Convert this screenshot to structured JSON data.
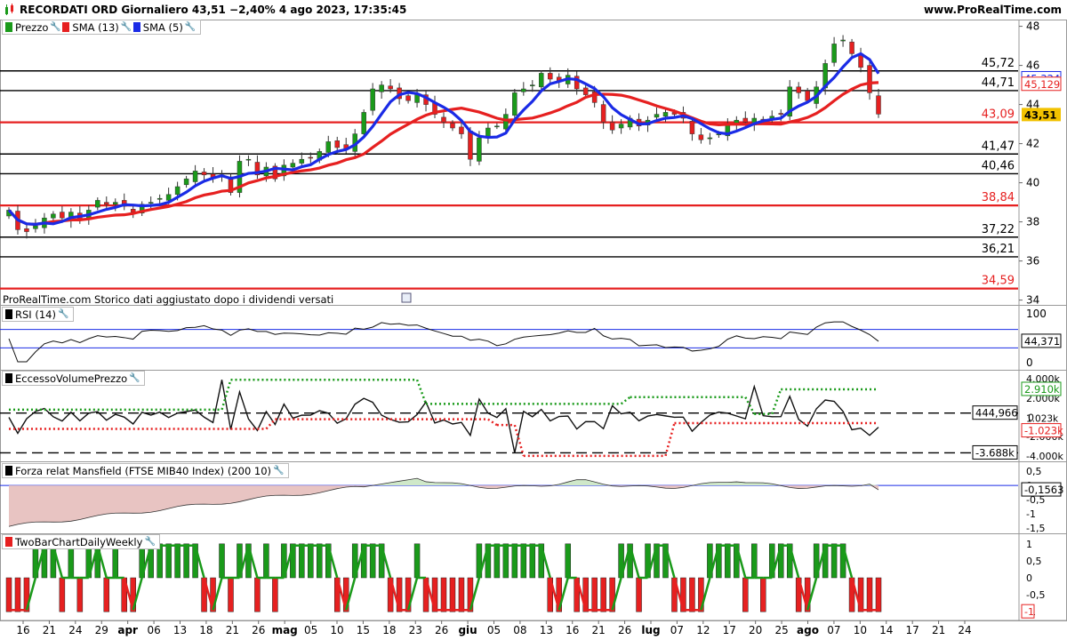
{
  "header": {
    "title": "RECORDATI ORD Giornaliero 43,51 −2,40% 4 ago 2023, 17:35:45",
    "site": "www.ProRealTime.com"
  },
  "price_panel": {
    "legend": [
      "Prezzo",
      "SMA (13)",
      "SMA (5)"
    ],
    "legend_colors": [
      "#1a9a1a",
      "#e62020",
      "#1a2be6"
    ],
    "y_ticks": [
      "48",
      "46",
      "44",
      "42",
      "40",
      "38",
      "36",
      "34"
    ],
    "levels": [
      "45,72",
      "44,71",
      "43,09",
      "41,47",
      "40,46",
      "38,84",
      "37,22",
      "36,21",
      "34,59"
    ],
    "red_levels": [
      "43,09",
      "38,84",
      "34,59"
    ],
    "tag_sma5": "45,324",
    "tag_sma13": "45,129",
    "tag_price": "43,51",
    "note": "ProRealTime.com Storico dati aggiustato dopo i dividendi versati"
  },
  "rsi_panel": {
    "legend": "RSI (14)",
    "ticks": [
      "100",
      "0"
    ],
    "tag": "44,371"
  },
  "evp_panel": {
    "legend": "EccessoVolumePrezzo",
    "ticks": [
      "4.000k",
      "2.000k",
      "0",
      "-2.000k",
      "-4.000k"
    ],
    "tag_upper": "2.910k",
    "tag_mid": "444,966",
    "tag_lower": "-1.023k",
    "tag_lower2": "1.023k",
    "tag_min": "-3.688k"
  },
  "mansfield_panel": {
    "legend": "Forza relat Mansfield (FTSE MIB40 Index) (200 10)",
    "ticks": [
      "0,5",
      "0",
      "-0,5",
      "-1",
      "-1,5"
    ],
    "tag": "-0,1563"
  },
  "twobar_panel": {
    "legend": "TwoBarChartDailyWeekly",
    "ticks": [
      "1",
      "0,5",
      "0",
      "-0,5",
      "-1"
    ]
  },
  "x_axis": {
    "labels": [
      "16",
      "21",
      "24",
      "29",
      "apr",
      "06",
      "13",
      "18",
      "21",
      "26",
      "mag",
      "05",
      "10",
      "15",
      "18",
      "23",
      "26",
      "giu",
      "05",
      "08",
      "13",
      "16",
      "21",
      "26",
      "lug",
      "07",
      "12",
      "17",
      "20",
      "25",
      "ago",
      "07",
      "10",
      "14",
      "17",
      "21",
      "24"
    ],
    "bold": [
      "apr",
      "mag",
      "giu",
      "lug",
      "ago"
    ]
  },
  "chart_data": [
    {
      "type": "candlestick",
      "title": "RECORDATI ORD Giornaliero",
      "ylim": [
        33.8,
        48.3
      ],
      "dates": [
        "16 mar",
        "17 mar",
        "20 mar",
        "21 mar",
        "22 mar",
        "23 mar",
        "24 mar",
        "27 mar",
        "28 mar",
        "29 mar",
        "30 mar",
        "31 mar",
        "3 apr",
        "4 apr",
        "5 apr",
        "6 apr",
        "11 apr",
        "12 apr",
        "13 apr",
        "14 apr",
        "17 apr",
        "18 apr",
        "19 apr",
        "20 apr",
        "21 apr",
        "24 apr",
        "25 apr",
        "26 apr",
        "27 apr",
        "28 apr",
        "2 mag",
        "3 mag",
        "4 mag",
        "5 mag",
        "8 mag",
        "9 mag",
        "10 mag",
        "11 mag",
        "12 mag",
        "15 mag",
        "16 mag",
        "17 mag",
        "18 mag",
        "19 mag",
        "22 mag",
        "23 mag",
        "24 mag",
        "25 mag",
        "26 mag",
        "29 mag",
        "30 mag",
        "31 mag",
        "1 giu",
        "2 giu",
        "5 giu",
        "6 giu",
        "7 giu",
        "8 giu",
        "9 giu",
        "12 giu",
        "13 giu",
        "14 giu",
        "15 giu",
        "16 giu",
        "19 giu",
        "20 giu",
        "21 giu",
        "22 giu",
        "23 giu",
        "26 giu",
        "27 giu",
        "28 giu",
        "29 giu",
        "30 giu",
        "3 lug",
        "4 lug",
        "5 lug",
        "6 lug",
        "7 lug",
        "10 lug",
        "11 lug",
        "12 lug",
        "13 lug",
        "14 lug",
        "17 lug",
        "18 lug",
        "19 lug",
        "20 lug",
        "21 lug",
        "24 lug",
        "25 lug",
        "26 lug",
        "27 lug",
        "28 lug",
        "31 lug",
        "1 ago",
        "2 ago",
        "3 ago",
        "4 ago"
      ],
      "close": [
        38.6,
        37.6,
        37.5,
        37.8,
        38.2,
        38.4,
        38.2,
        38.5,
        38.1,
        38.6,
        39.1,
        38.9,
        39.0,
        38.8,
        38.5,
        38.9,
        39.0,
        39.2,
        39.4,
        39.8,
        40.2,
        40.6,
        40.4,
        40.2,
        40.4,
        39.5,
        41.1,
        41.2,
        40.4,
        40.8,
        40.2,
        40.9,
        41.0,
        41.2,
        41.3,
        41.6,
        42.1,
        41.8,
        41.7,
        42.5,
        43.6,
        44.8,
        45.0,
        44.8,
        44.3,
        44.2,
        44.5,
        44.0,
        43.5,
        43.1,
        42.8,
        42.5,
        41.2,
        42.3,
        42.8,
        42.9,
        43.5,
        44.6,
        44.8,
        45.0,
        45.6,
        45.3,
        45.2,
        45.5,
        44.8,
        44.5,
        44.1,
        43.1,
        42.7,
        43.0,
        43.3,
        42.9,
        43.2,
        43.5,
        43.6,
        43.5,
        43.3,
        42.5,
        42.2,
        42.3,
        42.5,
        43.0,
        43.2,
        43.1,
        43.3,
        43.2,
        43.4,
        43.5,
        44.9,
        44.6,
        44.2,
        44.9,
        46.1,
        47.1,
        47.3,
        46.6,
        45.9,
        44.6,
        43.51
      ]
    },
    {
      "type": "line",
      "name": "RSI (14)",
      "ylim": [
        0,
        100
      ],
      "last": 44.371
    },
    {
      "type": "line",
      "name": "EccessoVolumePrezzo",
      "upper_band": 2910,
      "lower_band": -1023,
      "last": 444.966,
      "min": -3688
    },
    {
      "type": "area",
      "name": "Forza relat Mansfield (FTSE MIB40 Index) (200 10)",
      "ylim": [
        -1.6,
        0.6
      ],
      "last": -0.1563
    },
    {
      "type": "bar",
      "name": "TwoBarChartDailyWeekly",
      "ylim": [
        -1,
        1
      ]
    }
  ]
}
